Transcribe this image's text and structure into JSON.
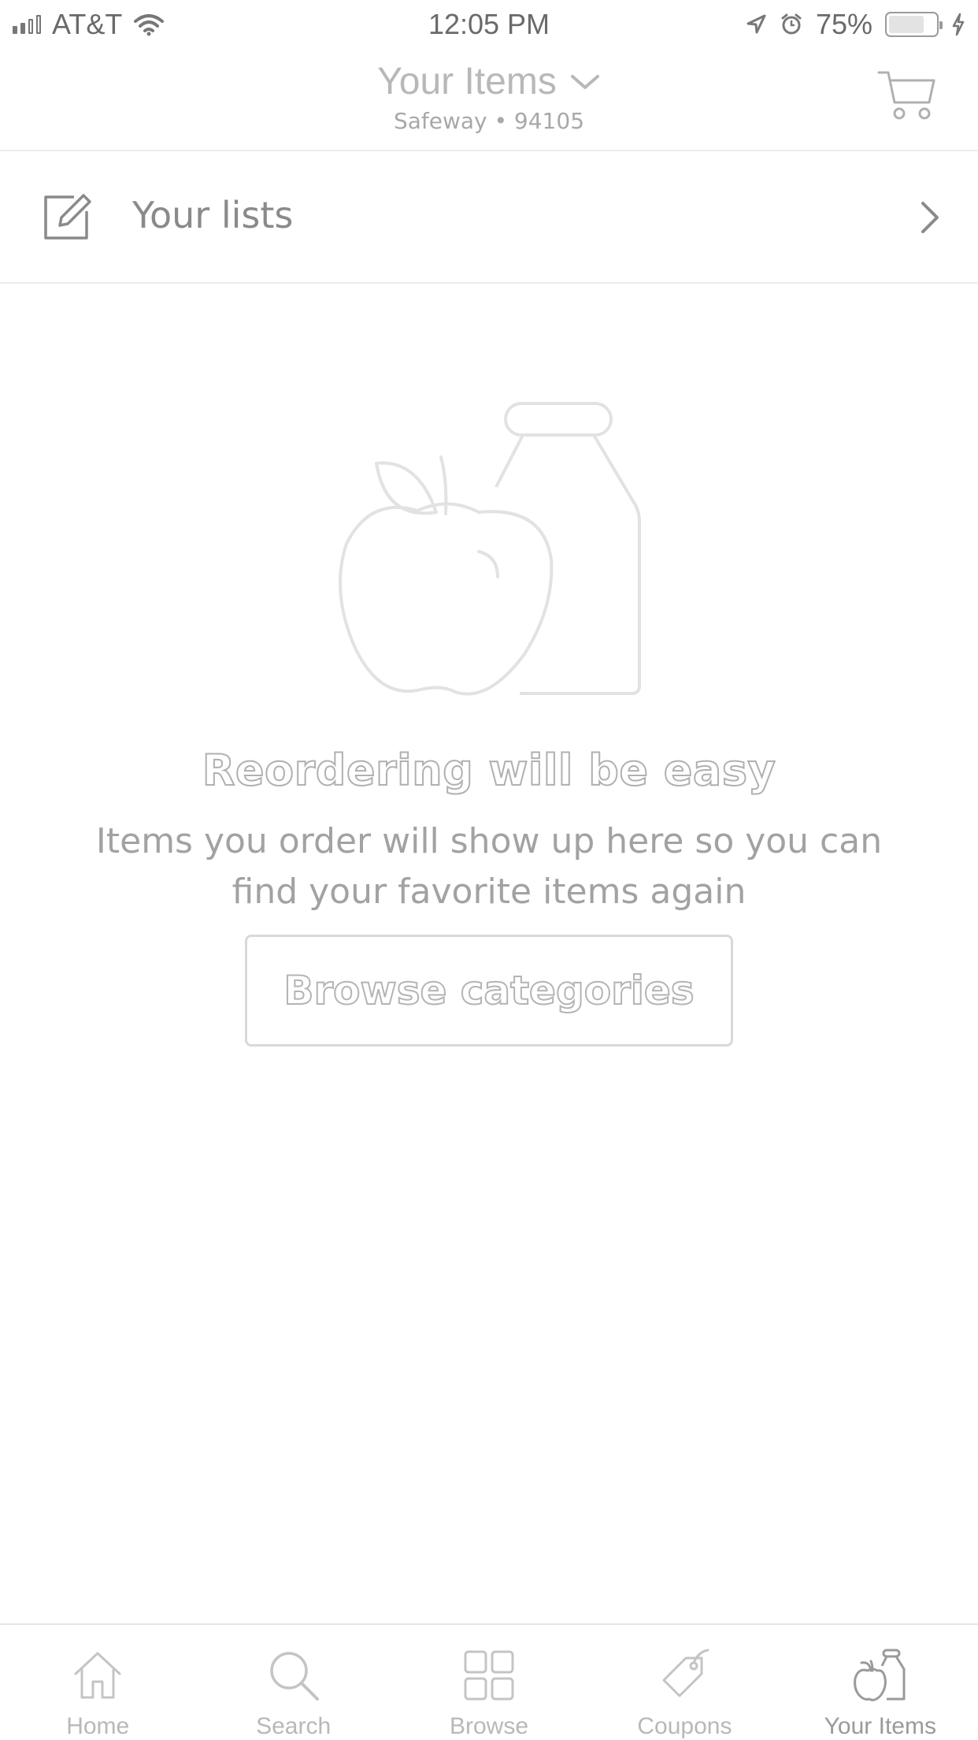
{
  "status_bar": {
    "carrier": "AT&T",
    "time": "12:05 PM",
    "battery_percent": "75%",
    "battery_level": 0.75,
    "icons": [
      "signal-icon",
      "wifi-icon",
      "location-icon",
      "alarm-icon",
      "battery-icon",
      "charging-icon"
    ]
  },
  "header": {
    "title": "Your Items",
    "subtitle": "Safeway • 94105",
    "icons": [
      "chevron-down-icon",
      "cart-icon"
    ]
  },
  "lists_row": {
    "label": "Your lists",
    "icons": [
      "edit-icon",
      "chevron-right-icon"
    ]
  },
  "empty_state": {
    "illustration": "apple-and-milk-bottle-illustration",
    "heading": "Reordering will be easy",
    "body": "Items you order will show up here so you can find your favorite items again",
    "button_label": "Browse categories"
  },
  "tab_bar": {
    "items": [
      {
        "label": "Home",
        "icon": "home-icon"
      },
      {
        "label": "Search",
        "icon": "search-icon"
      },
      {
        "label": "Browse",
        "icon": "grid-icon"
      },
      {
        "label": "Coupons",
        "icon": "tag-icon"
      },
      {
        "label": "Your Items",
        "icon": "apple-milk-icon"
      }
    ],
    "active_index": 4
  },
  "colors": {
    "background": "#ffffff",
    "text_muted": "#a2a2a2",
    "divider": "#ededed"
  }
}
